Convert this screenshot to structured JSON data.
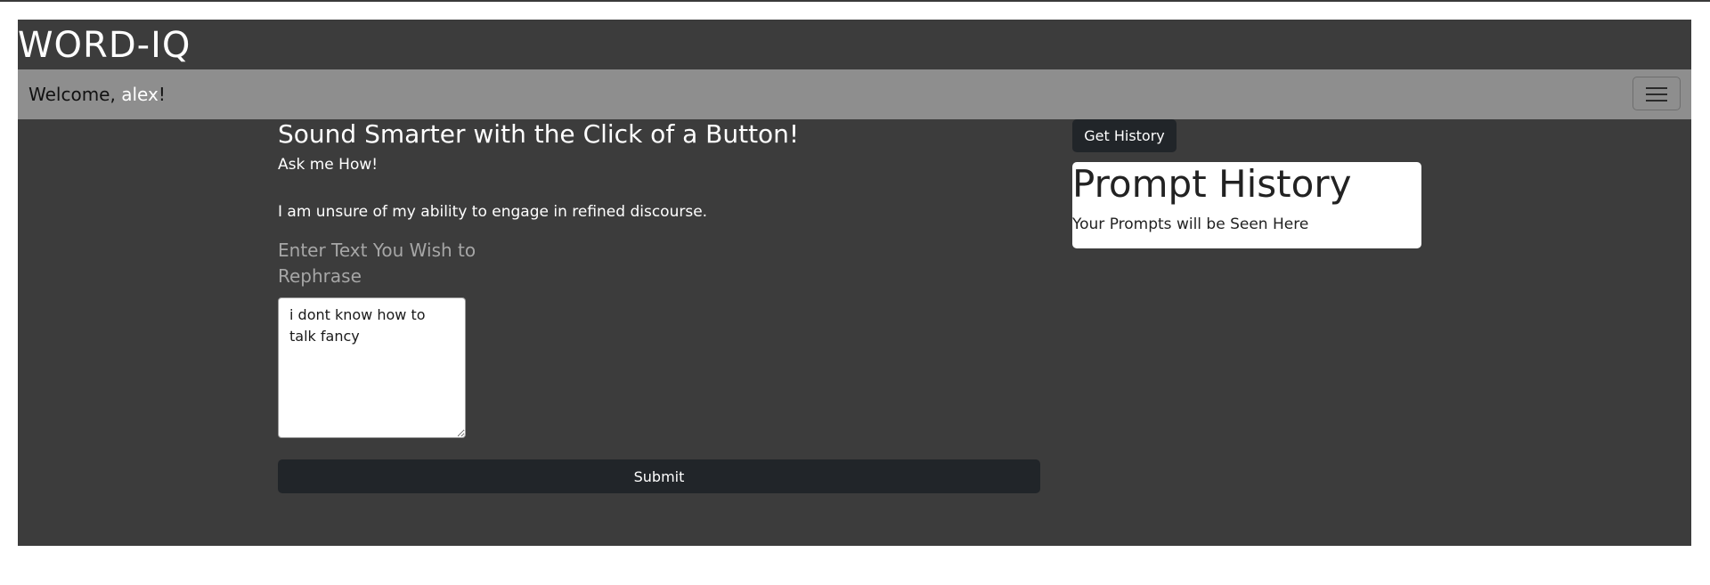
{
  "brand": {
    "title": "WORD-IQ"
  },
  "navbar": {
    "welcome_prefix": "Welcome, ",
    "username": "alex",
    "welcome_suffix": "!",
    "menu_icon": "hamburger-menu-icon"
  },
  "main": {
    "title": "Sound Smarter with the Click of a Button!",
    "subtitle": "Ask me How!",
    "result_text": "I am unsure of my ability to engage in refined discourse.",
    "input_label": "Enter Text You Wish to Rephrase",
    "input_value": "i dont know how to talk fancy",
    "submit_label": "Submit"
  },
  "history": {
    "button_label": "Get History",
    "title": "Prompt History",
    "placeholder": "Your Prompts will be Seen Here"
  },
  "colors": {
    "app_background": "#3c3c3c",
    "navbar_background": "#8e8e8e",
    "button_dark": "#212529"
  }
}
